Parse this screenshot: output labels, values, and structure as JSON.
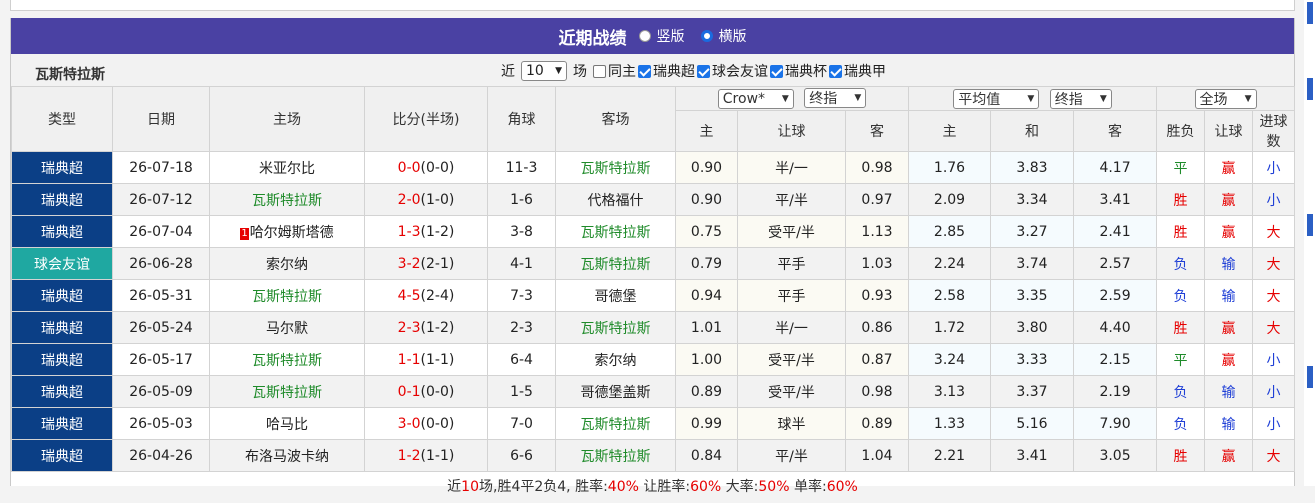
{
  "panel": {
    "title": "近期战绩",
    "view_vertical": "竖版",
    "view_horizontal": "横版",
    "team": "瓦斯特拉斯",
    "filter": {
      "near_label": "近",
      "count_value": "10",
      "games_label": "场",
      "same_home_label": "同主",
      "leagues": [
        {
          "label": "瑞典超",
          "checked": true
        },
        {
          "label": "球会友谊",
          "checked": true
        },
        {
          "label": "瑞典杯",
          "checked": true
        },
        {
          "label": "瑞典甲",
          "checked": true
        }
      ]
    },
    "headers": {
      "type": "类型",
      "date": "日期",
      "home": "主场",
      "score": "比分(半场)",
      "corner": "角球",
      "away": "客场",
      "company_select": "Crow*",
      "odds_kind_select_1": "终指",
      "avg_select": "平均值",
      "odds_kind_select_2": "终指",
      "scope_select": "全场",
      "sub": {
        "home": "主",
        "handicap": "让球",
        "away": "客",
        "eu_home": "主",
        "eu_draw": "和",
        "eu_away": "客",
        "result": "胜负",
        "hc_result": "让球",
        "goals": "进球数"
      }
    },
    "colors": {
      "league_main": "#0b3f86",
      "league_friendly": "#1fa8a1",
      "title_bg": "#4a41a3",
      "win": "#e60000",
      "loss": "#1f3fd6",
      "draw": "#1f8b2a"
    },
    "rows": [
      {
        "league": "瑞典超",
        "league_kind": "sc",
        "date": "26-07-18",
        "home": "米亚尔比",
        "home_style": "",
        "home_rank": "",
        "score": "0-0",
        "half": "(0-0)",
        "corner": "11-3",
        "away": "瓦斯特拉斯",
        "away_style": "grn",
        "o_home": "0.90",
        "handicap": "半/一",
        "o_away": "0.98",
        "e_home": "1.76",
        "e_draw": "3.83",
        "e_away": "4.17",
        "result": "平",
        "result_c": "grn",
        "hc": "赢",
        "hc_c": "red",
        "goals": "小",
        "goals_c": "blu"
      },
      {
        "league": "瑞典超",
        "league_kind": "sc",
        "date": "26-07-12",
        "home": "瓦斯特拉斯",
        "home_style": "grn",
        "home_rank": "",
        "score": "2-0",
        "half": "(1-0)",
        "corner": "1-6",
        "away": "代格福什",
        "away_style": "",
        "o_home": "0.90",
        "handicap": "平/半",
        "o_away": "0.97",
        "e_home": "2.09",
        "e_draw": "3.34",
        "e_away": "3.41",
        "result": "胜",
        "result_c": "red",
        "hc": "赢",
        "hc_c": "red",
        "goals": "小",
        "goals_c": "blu"
      },
      {
        "league": "瑞典超",
        "league_kind": "sc",
        "date": "26-07-04",
        "home": "哈尔姆斯塔德",
        "home_style": "",
        "home_rank": "1",
        "score": "1-3",
        "half": "(1-2)",
        "corner": "3-8",
        "away": "瓦斯特拉斯",
        "away_style": "grn",
        "o_home": "0.75",
        "handicap": "受平/半",
        "o_away": "1.13",
        "e_home": "2.85",
        "e_draw": "3.27",
        "e_away": "2.41",
        "result": "胜",
        "result_c": "red",
        "hc": "赢",
        "hc_c": "red",
        "goals": "大",
        "goals_c": "red"
      },
      {
        "league": "球会友谊",
        "league_kind": "fr",
        "date": "26-06-28",
        "home": "索尔纳",
        "home_style": "",
        "home_rank": "",
        "score": "3-2",
        "half": "(2-1)",
        "corner": "4-1",
        "away": "瓦斯特拉斯",
        "away_style": "grn",
        "o_home": "0.79",
        "handicap": "平手",
        "o_away": "1.03",
        "e_home": "2.24",
        "e_draw": "3.74",
        "e_away": "2.57",
        "result": "负",
        "result_c": "blu",
        "hc": "输",
        "hc_c": "blu",
        "goals": "大",
        "goals_c": "red"
      },
      {
        "league": "瑞典超",
        "league_kind": "sc",
        "date": "26-05-31",
        "home": "瓦斯特拉斯",
        "home_style": "grn",
        "home_rank": "",
        "score": "4-5",
        "half": "(2-4)",
        "corner": "7-3",
        "away": "哥德堡",
        "away_style": "",
        "o_home": "0.94",
        "handicap": "平手",
        "o_away": "0.93",
        "e_home": "2.58",
        "e_draw": "3.35",
        "e_away": "2.59",
        "result": "负",
        "result_c": "blu",
        "hc": "输",
        "hc_c": "blu",
        "goals": "大",
        "goals_c": "red"
      },
      {
        "league": "瑞典超",
        "league_kind": "sc",
        "date": "26-05-24",
        "home": "马尔默",
        "home_style": "",
        "home_rank": "",
        "score": "2-3",
        "half": "(1-2)",
        "corner": "2-3",
        "away": "瓦斯特拉斯",
        "away_style": "grn",
        "o_home": "1.01",
        "handicap": "半/一",
        "o_away": "0.86",
        "e_home": "1.72",
        "e_draw": "3.80",
        "e_away": "4.40",
        "result": "胜",
        "result_c": "red",
        "hc": "赢",
        "hc_c": "red",
        "goals": "大",
        "goals_c": "red"
      },
      {
        "league": "瑞典超",
        "league_kind": "sc",
        "date": "26-05-17",
        "home": "瓦斯特拉斯",
        "home_style": "grn",
        "home_rank": "",
        "score": "1-1",
        "half": "(1-1)",
        "corner": "6-4",
        "away": "索尔纳",
        "away_style": "",
        "o_home": "1.00",
        "handicap": "受平/半",
        "o_away": "0.87",
        "e_home": "3.24",
        "e_draw": "3.33",
        "e_away": "2.15",
        "result": "平",
        "result_c": "grn",
        "hc": "赢",
        "hc_c": "red",
        "goals": "小",
        "goals_c": "blu"
      },
      {
        "league": "瑞典超",
        "league_kind": "sc",
        "date": "26-05-09",
        "home": "瓦斯特拉斯",
        "home_style": "grn",
        "home_rank": "",
        "score": "0-1",
        "half": "(0-0)",
        "corner": "1-5",
        "away": "哥德堡盖斯",
        "away_style": "",
        "o_home": "0.89",
        "handicap": "受平/半",
        "o_away": "0.98",
        "e_home": "3.13",
        "e_draw": "3.37",
        "e_away": "2.19",
        "result": "负",
        "result_c": "blu",
        "hc": "输",
        "hc_c": "blu",
        "goals": "小",
        "goals_c": "blu"
      },
      {
        "league": "瑞典超",
        "league_kind": "sc",
        "date": "26-05-03",
        "home": "哈马比",
        "home_style": "",
        "home_rank": "",
        "score": "3-0",
        "half": "(0-0)",
        "corner": "7-0",
        "away": "瓦斯特拉斯",
        "away_style": "grn",
        "o_home": "0.99",
        "handicap": "球半",
        "o_away": "0.89",
        "e_home": "1.33",
        "e_draw": "5.16",
        "e_away": "7.90",
        "result": "负",
        "result_c": "blu",
        "hc": "输",
        "hc_c": "blu",
        "goals": "小",
        "goals_c": "blu"
      },
      {
        "league": "瑞典超",
        "league_kind": "sc",
        "date": "26-04-26",
        "home": "布洛马波卡纳",
        "home_style": "",
        "home_rank": "",
        "score": "1-2",
        "half": "(1-1)",
        "corner": "6-6",
        "away": "瓦斯特拉斯",
        "away_style": "grn",
        "o_home": "0.84",
        "handicap": "平/半",
        "o_away": "1.04",
        "e_home": "2.21",
        "e_draw": "3.41",
        "e_away": "3.05",
        "result": "胜",
        "result_c": "red",
        "hc": "赢",
        "hc_c": "red",
        "goals": "大",
        "goals_c": "red"
      }
    ],
    "summary": {
      "t1": "近",
      "n": "10",
      "t2": "场,胜4平2负4, 胜率:",
      "win_rate": "40%",
      "t3": " 让胜率:",
      "hc_rate": "60%",
      "t4": " 大率:",
      "big_rate": "50%",
      "t5": " 单率:",
      "odd_rate": "60%"
    }
  }
}
